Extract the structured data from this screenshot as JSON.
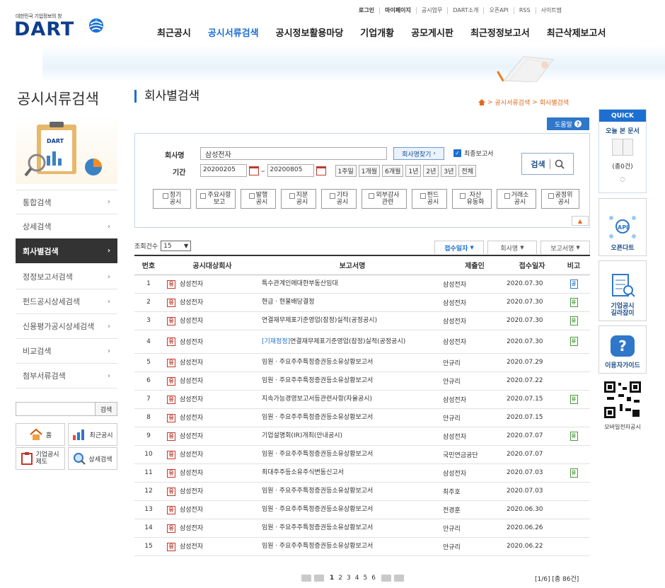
{
  "header": {
    "logo_sub": "대한민국 기업정보의 창",
    "logo_text": "DART",
    "util_links": [
      "로그인",
      "마이페이지",
      "공시업무",
      "DART소개",
      "오픈API",
      "RSS",
      "사이트맵"
    ],
    "gnb": [
      "최근공시",
      "공시서류검색",
      "공시정보활용마당",
      "기업개황",
      "공모게시판",
      "최근정정보고서",
      "최근삭제보고서"
    ],
    "gnb_active_index": 1
  },
  "sidebar": {
    "title": "공시서류검색",
    "items": [
      {
        "label": "통합검색"
      },
      {
        "label": "상세검색"
      },
      {
        "label": "회사별검색",
        "active": true
      },
      {
        "label": "정정보고서검색"
      },
      {
        "label": "펀드공시상세검색"
      },
      {
        "label": "신용평가공시상세검색"
      },
      {
        "label": "비교검색"
      },
      {
        "label": "첨부서류검색"
      }
    ],
    "search_button": "검색",
    "quick_buttons": [
      "홈",
      "최근공시",
      "기업공시\n제도",
      "상세검색"
    ]
  },
  "main": {
    "title": "회사별검색",
    "breadcrumb": [
      "공시서류검색",
      "회사별검색"
    ],
    "help_label": "도움말",
    "form": {
      "company_label": "회사명",
      "company_value": "삼성전자",
      "find_company_label": "회사명찾기",
      "latest_report_label": "최종보고서",
      "latest_report_checked": true,
      "period_label": "기간",
      "date_from": "20200205",
      "date_to": "20200805",
      "period_buttons": [
        "1주일",
        "1개월",
        "6개월",
        "1년",
        "2년",
        "3년",
        "전체"
      ],
      "search_label": "검색",
      "categories": [
        "정기\n공시",
        "주요사항\n보고",
        "발행\n공시",
        "지분\n공시",
        "기타\n공시",
        "외부감사\n관련",
        "펀드\n공시",
        "자산\n유동화",
        "거래소\n공시",
        "공정위\n공시"
      ]
    },
    "count_label": "조회건수",
    "count_value": "15",
    "sort_tabs": [
      {
        "label": "접수일자",
        "active": true
      },
      {
        "label": "회사명",
        "active": false
      },
      {
        "label": "보고서명",
        "active": false
      }
    ],
    "table": {
      "headers": [
        "번호",
        "공시대상회사",
        "보고서명",
        "제출인",
        "접수일자",
        "비고"
      ],
      "rows": [
        {
          "no": "1",
          "corp": "삼성전자",
          "report_tag": "",
          "report": "특수관계인에대한부동산임대",
          "submitter": "삼성전자",
          "date": "2020.07.30",
          "note": "공"
        },
        {
          "no": "2",
          "corp": "삼성전자",
          "report_tag": "",
          "report": "현금ㆍ현물배당결정",
          "submitter": "삼성전자",
          "date": "2020.07.30",
          "note": "유"
        },
        {
          "no": "3",
          "corp": "삼성전자",
          "report_tag": "",
          "report": "연결재무제표기준영업(잠정)실적(공정공시)",
          "submitter": "삼성전자",
          "date": "2020.07.30",
          "note": "유"
        },
        {
          "no": "4",
          "corp": "삼성전자",
          "report_tag": "[기재정정]",
          "report": "연결재무제표기준영업(잠정)실적(공정공시)",
          "submitter": "삼성전자",
          "date": "2020.07.30",
          "note": "유"
        },
        {
          "no": "5",
          "corp": "삼성전자",
          "report_tag": "",
          "report": "임원ㆍ주요주주특정증권등소유상황보고서",
          "submitter": "안규리",
          "date": "2020.07.29",
          "note": ""
        },
        {
          "no": "6",
          "corp": "삼성전자",
          "report_tag": "",
          "report": "임원ㆍ주요주주특정증권등소유상황보고서",
          "submitter": "안규리",
          "date": "2020.07.22",
          "note": ""
        },
        {
          "no": "7",
          "corp": "삼성전자",
          "report_tag": "",
          "report": "지속가능경영보고서등관련사항(자율공시)",
          "submitter": "삼성전자",
          "date": "2020.07.15",
          "note": "유"
        },
        {
          "no": "8",
          "corp": "삼성전자",
          "report_tag": "",
          "report": "임원ㆍ주요주주특정증권등소유상황보고서",
          "submitter": "안규리",
          "date": "2020.07.15",
          "note": ""
        },
        {
          "no": "9",
          "corp": "삼성전자",
          "report_tag": "",
          "report": "기업설명회(IR)개최(안내공시)",
          "submitter": "삼성전자",
          "date": "2020.07.07",
          "note": "유"
        },
        {
          "no": "10",
          "corp": "삼성전자",
          "report_tag": "",
          "report": "임원ㆍ주요주주특정증권등소유상황보고서",
          "submitter": "국민연금공단",
          "date": "2020.07.07",
          "note": ""
        },
        {
          "no": "11",
          "corp": "삼성전자",
          "report_tag": "",
          "report": "최대주주등소유주식변동신고서",
          "submitter": "삼성전자",
          "date": "2020.07.03",
          "note": "유"
        },
        {
          "no": "12",
          "corp": "삼성전자",
          "report_tag": "",
          "report": "임원ㆍ주요주주특정증권등소유상황보고서",
          "submitter": "최주호",
          "date": "2020.07.03",
          "note": ""
        },
        {
          "no": "13",
          "corp": "삼성전자",
          "report_tag": "",
          "report": "임원ㆍ주요주주특정증권등소유상황보고서",
          "submitter": "전경훈",
          "date": "2020.06.30",
          "note": ""
        },
        {
          "no": "14",
          "corp": "삼성전자",
          "report_tag": "",
          "report": "임원ㆍ주요주주특정증권등소유상황보고서",
          "submitter": "안규리",
          "date": "2020.06.26",
          "note": ""
        },
        {
          "no": "15",
          "corp": "삼성전자",
          "report_tag": "",
          "report": "임원ㆍ주요주주특정증권등소유상황보고서",
          "submitter": "안규리",
          "date": "2020.06.22",
          "note": ""
        }
      ],
      "corp_badge": "유"
    },
    "pager": {
      "pages": [
        "1",
        "2",
        "3",
        "4",
        "5",
        "6"
      ],
      "current": "1",
      "info": "[1/6] [총 86건]"
    }
  },
  "quick": {
    "head": "QUICK",
    "today_label": "오늘 본 문서",
    "today_count": "(총0건)",
    "cards": [
      "오픈다트",
      "기업공시\n길라잡이",
      "이용자가이드",
      "모바일전자공시"
    ]
  },
  "colors": {
    "accent": "#1d6fd1",
    "brand": "#0e3d8c",
    "badge": "#c0392b",
    "note_green": "#4b9a3c"
  }
}
